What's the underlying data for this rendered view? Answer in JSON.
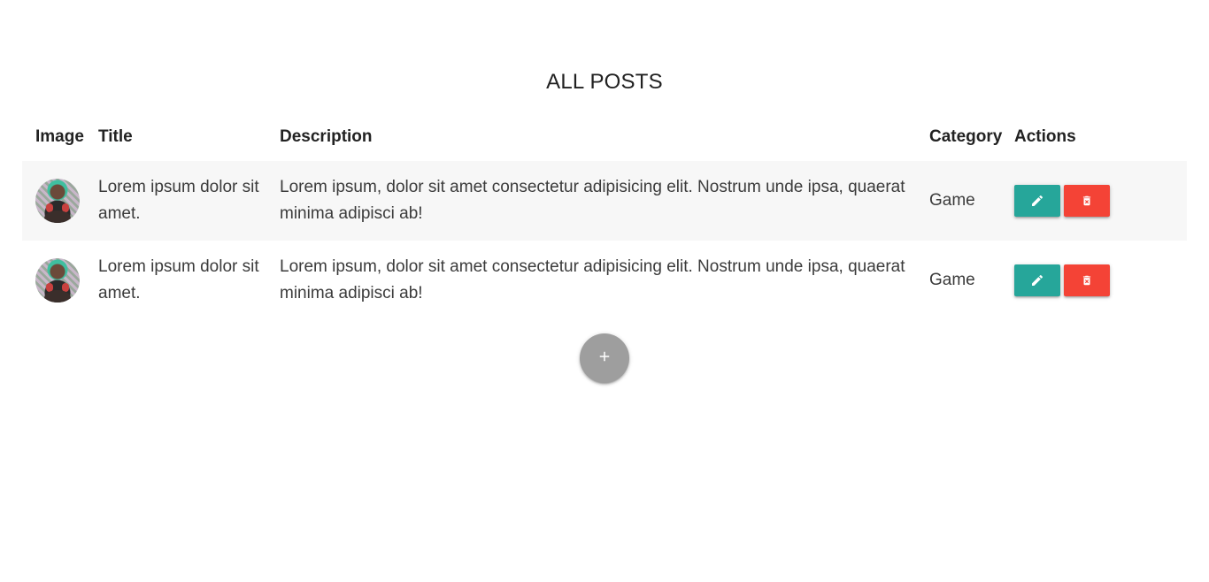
{
  "page": {
    "title": "ALL POSTS"
  },
  "table": {
    "headers": {
      "image": "Image",
      "title": "Title",
      "description": "Description",
      "category": "Category",
      "actions": "Actions"
    },
    "rows": [
      {
        "title": "Lorem ipsum dolor sit amet.",
        "description": "Lorem ipsum, dolor sit amet consectetur adipisicing elit. Nostrum unde ipsa, quaerat minima adipisci ab!",
        "category": "Game"
      },
      {
        "title": "Lorem ipsum dolor sit amet.",
        "description": "Lorem ipsum, dolor sit amet consectetur adipisicing elit. Nostrum unde ipsa, quaerat minima adipisci ab!",
        "category": "Game"
      }
    ]
  },
  "icons": {
    "edit": "pencil-icon",
    "delete": "trash-icon",
    "add": "plus-icon"
  },
  "colors": {
    "edit_button": "#26a69a",
    "delete_button": "#f44336",
    "add_button": "#9e9e9e",
    "striped_row": "#f7f7f7"
  }
}
